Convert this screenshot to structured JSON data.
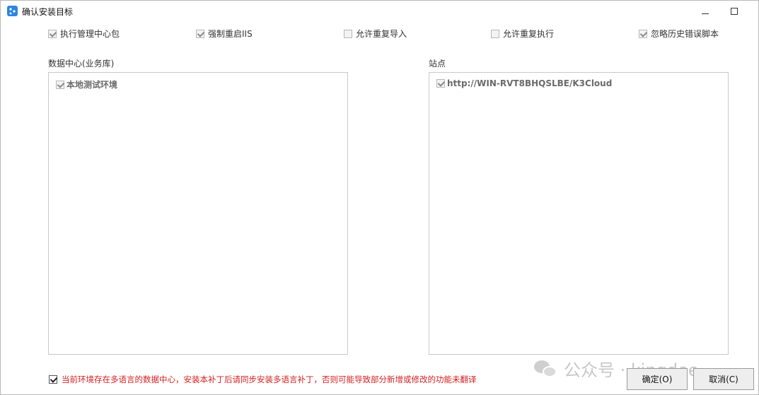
{
  "window": {
    "title": "确认安装目标"
  },
  "options": [
    {
      "label": "执行管理中心包",
      "checked": true
    },
    {
      "label": "强制重启IIS",
      "checked": true
    },
    {
      "label": "允许重复导入",
      "checked": false
    },
    {
      "label": "允许重复执行",
      "checked": false
    },
    {
      "label": "忽略历史错误脚本",
      "checked": true
    }
  ],
  "datacenter": {
    "label": "数据中心(业务库)",
    "items": [
      {
        "label": "本地测试环境",
        "checked": true
      }
    ]
  },
  "sites": {
    "label": "站点",
    "items": [
      {
        "label": "http://WIN-RVT8BHQSLBE/K3Cloud",
        "checked": true
      }
    ]
  },
  "warning": {
    "text": "当前环境存在多语言的数据中心，安装本补丁后请同步安装多语言补丁，否则可能导致部分新增或修改的功能未翻译",
    "checked": true
  },
  "buttons": {
    "ok": "确定(O)",
    "cancel": "取消(C)"
  },
  "watermark": {
    "text": "公众号 · kingdee"
  },
  "colors": {
    "warning": "#d21f1f",
    "icon": "#2e86de"
  }
}
